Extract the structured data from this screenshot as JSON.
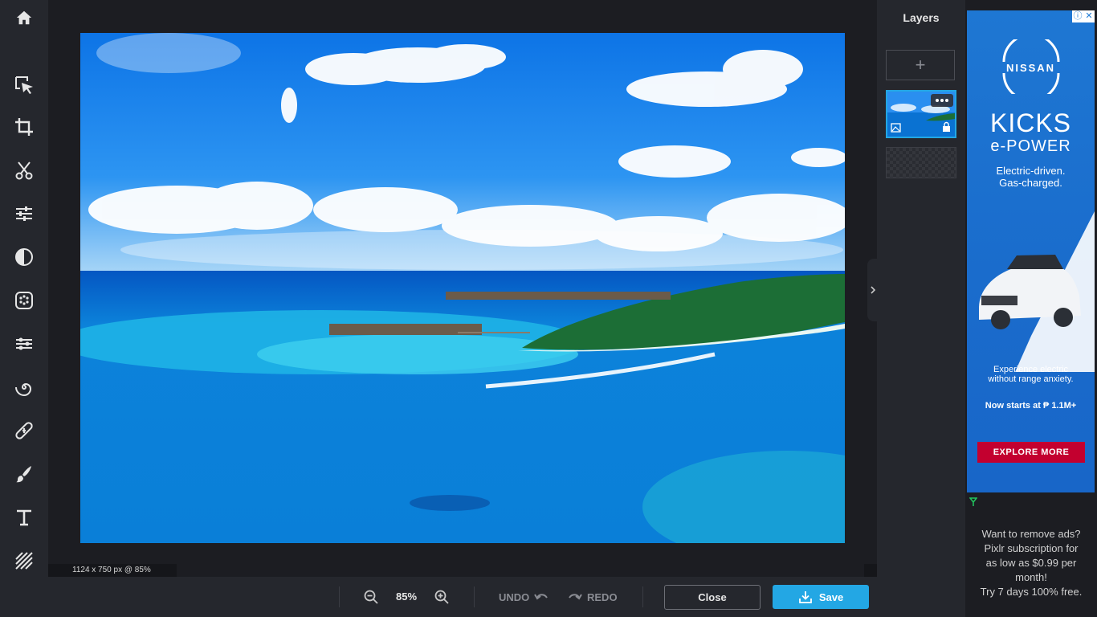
{
  "layers_panel": {
    "title": "Layers",
    "add_symbol": "+"
  },
  "status": {
    "dimensions": "1124 x 750 px @ 85%"
  },
  "bottom_bar": {
    "zoom": "85%",
    "undo_label": "UNDO",
    "redo_label": "REDO",
    "close_label": "Close",
    "save_label": "Save"
  },
  "toolbar": {
    "items": [
      "home-icon",
      "arrange-icon",
      "crop-icon",
      "cutout-icon",
      "adjust-icon",
      "filter-icon",
      "effect-icon",
      "liquify-icon",
      "distort-icon",
      "retouch-icon",
      "draw-icon",
      "text-icon",
      "elements-icon"
    ]
  },
  "ad": {
    "brand": "NISSAN",
    "model": "KICKS",
    "variant": "e-POWER",
    "tagline1": "Electric-driven.",
    "tagline2": "Gas-charged.",
    "copy1": "Experience electric",
    "copy2": "without range anxiety.",
    "price": "Now starts at ₱ 1.1M+",
    "cta": "EXPLORE MORE",
    "info_icon": "ⓘ",
    "close_icon": "✕"
  },
  "remove_ads": {
    "line1": "Want to remove ads?",
    "line2": "Pixlr subscription for",
    "line3": "as low as $0.99 per",
    "line4": "month!",
    "line5": "Try 7 days 100% free."
  },
  "colors": {
    "accent": "#23a7e4",
    "panel": "#25272d",
    "workspace": "#1c1d22",
    "ad_cta": "#c3002f"
  }
}
